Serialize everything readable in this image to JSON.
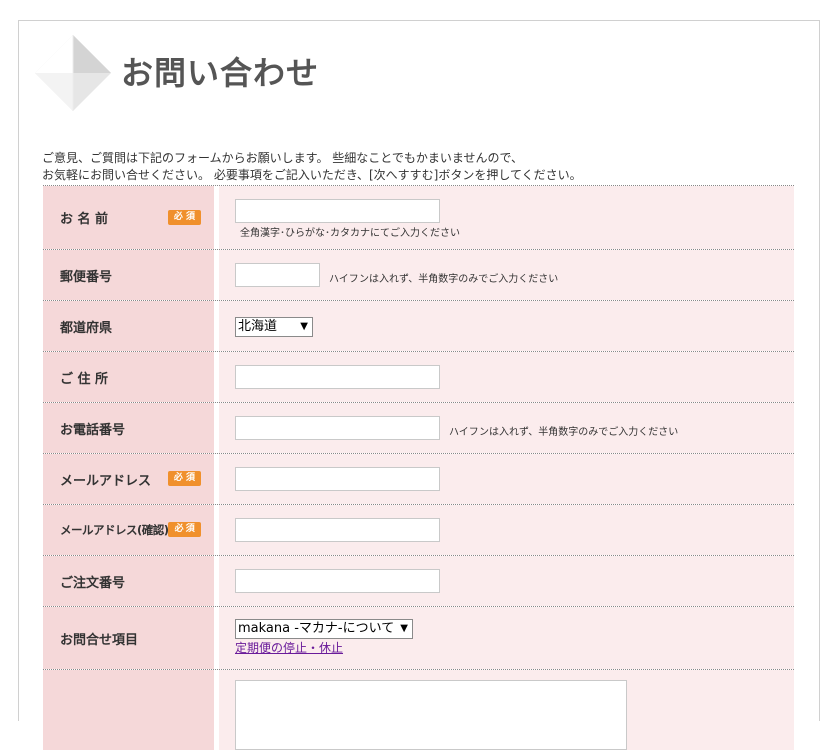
{
  "page": {
    "title": "お問い合わせ",
    "intro_line1": "ご意見、ご質問は下記のフォームからお願いします。 些細なことでもかまいませんので、",
    "intro_line2": "お気軽にお問い合せください。 必要事項をご記入いただき、[次へすすむ]ボタンを押してください。"
  },
  "colors": {
    "label_bg": "#f5d8d9",
    "value_bg": "#fbeced",
    "required_badge": "#f0902c",
    "link": "#6a1b9a"
  },
  "icons": {
    "header": "envelope-icon"
  },
  "form": {
    "required_label": "必 須",
    "name": {
      "label": "お 名 前",
      "hint": "全角漢字･ひらがな･カタカナにてご入力ください",
      "value": ""
    },
    "postal": {
      "label": "郵便番号",
      "hint": "ハイフンは入れず、半角数字のみでご入力ください",
      "value": ""
    },
    "prefecture": {
      "label": "都道府県",
      "selected": "北海道"
    },
    "address": {
      "label": "ご 住 所",
      "value": ""
    },
    "phone": {
      "label": "お電話番号",
      "hint": "ハイフンは入れず、半角数字のみでご入力ください",
      "value": ""
    },
    "email": {
      "label": "メールアドレス",
      "value": ""
    },
    "email_confirm": {
      "label": "メールアドレス(確認)",
      "value": ""
    },
    "order_number": {
      "label": "ご注文番号",
      "value": ""
    },
    "inquiry": {
      "label": "お問合せ項目",
      "selected": "makana -マカナ-について",
      "link": "定期便の停止・休止"
    },
    "message": {
      "label": "",
      "value": ""
    }
  }
}
